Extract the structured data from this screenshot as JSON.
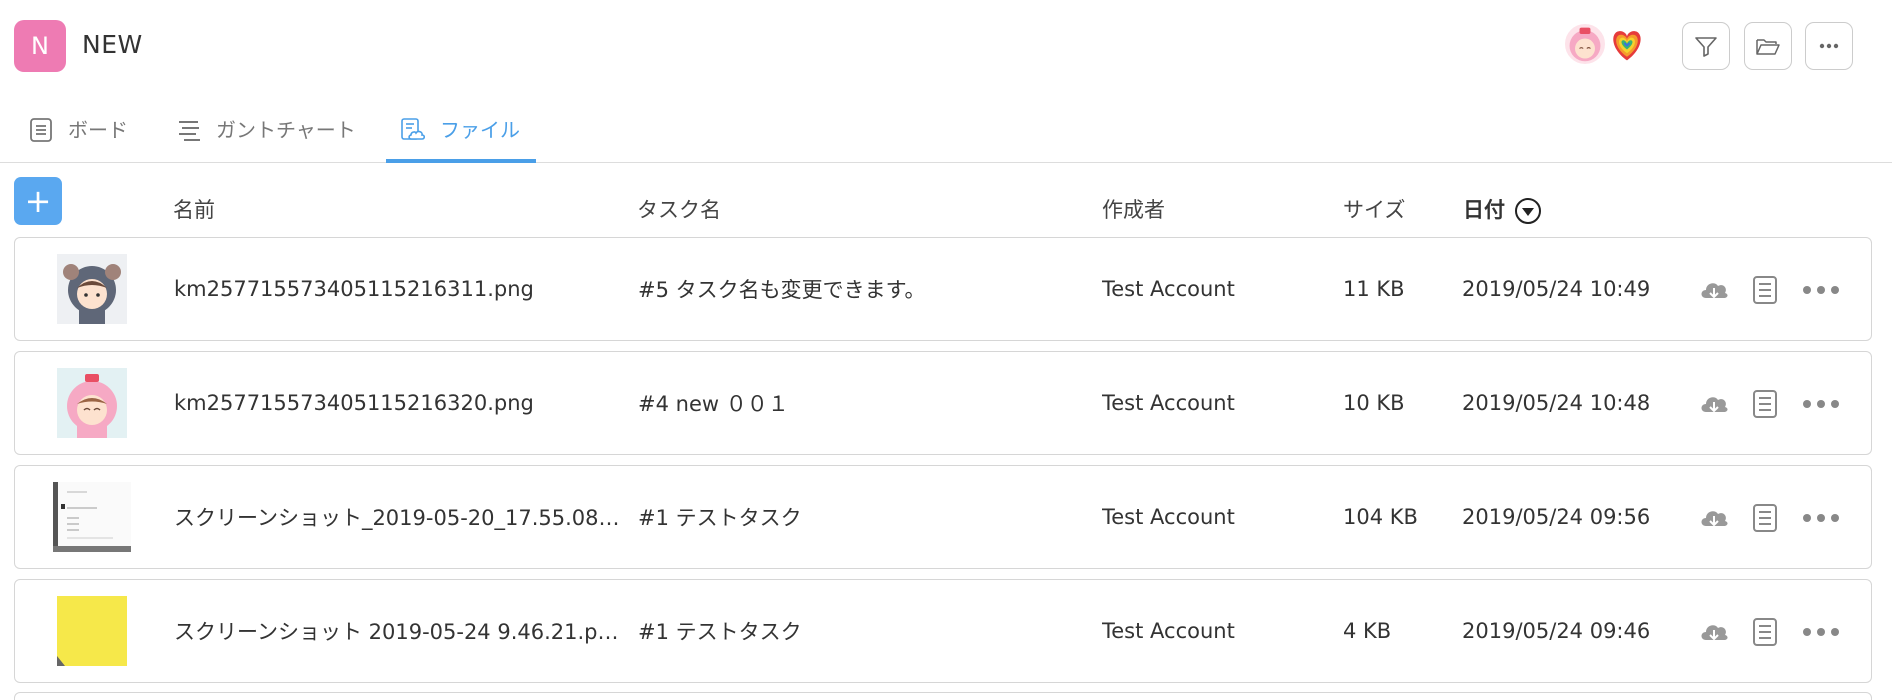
{
  "header": {
    "badge_letter": "N",
    "badge_color": "#ee7bb3",
    "title": "NEW",
    "buttons": [
      "filter-icon",
      "folder-icon",
      "more-icon"
    ]
  },
  "tabs": [
    {
      "label": "ボード",
      "icon": "board-icon",
      "active": false
    },
    {
      "label": "ガントチャート",
      "icon": "gantt-icon",
      "active": false
    },
    {
      "label": "ファイル",
      "icon": "file-icon",
      "active": true
    }
  ],
  "accent_color": "#4a9fe8",
  "table": {
    "add_label": "+",
    "columns": {
      "name": "名前",
      "task": "タスク名",
      "author": "作成者",
      "size": "サイズ",
      "date": "日付"
    },
    "rows": [
      {
        "name": "km257715573405115216311.png",
        "task": "#5 タスク名も変更できます。",
        "author": "Test Account",
        "size": "11 KB",
        "date": "2019/05/24 10:49"
      },
      {
        "name": "km257715573405115216320.png",
        "task": "#4 new ００１",
        "author": "Test Account",
        "size": "10 KB",
        "date": "2019/05/24 10:48"
      },
      {
        "name": "スクリーンショット_2019-05-20_17.55.08…",
        "task": "#1 テストタスク",
        "author": "Test Account",
        "size": "104 KB",
        "date": "2019/05/24 09:56"
      },
      {
        "name": "スクリーンショット 2019-05-24 9.46.21.p…",
        "task": "#1 テストタスク",
        "author": "Test Account",
        "size": "4 KB",
        "date": "2019/05/24 09:46"
      }
    ],
    "row_actions": [
      "download-icon",
      "details-icon",
      "more-icon"
    ]
  }
}
